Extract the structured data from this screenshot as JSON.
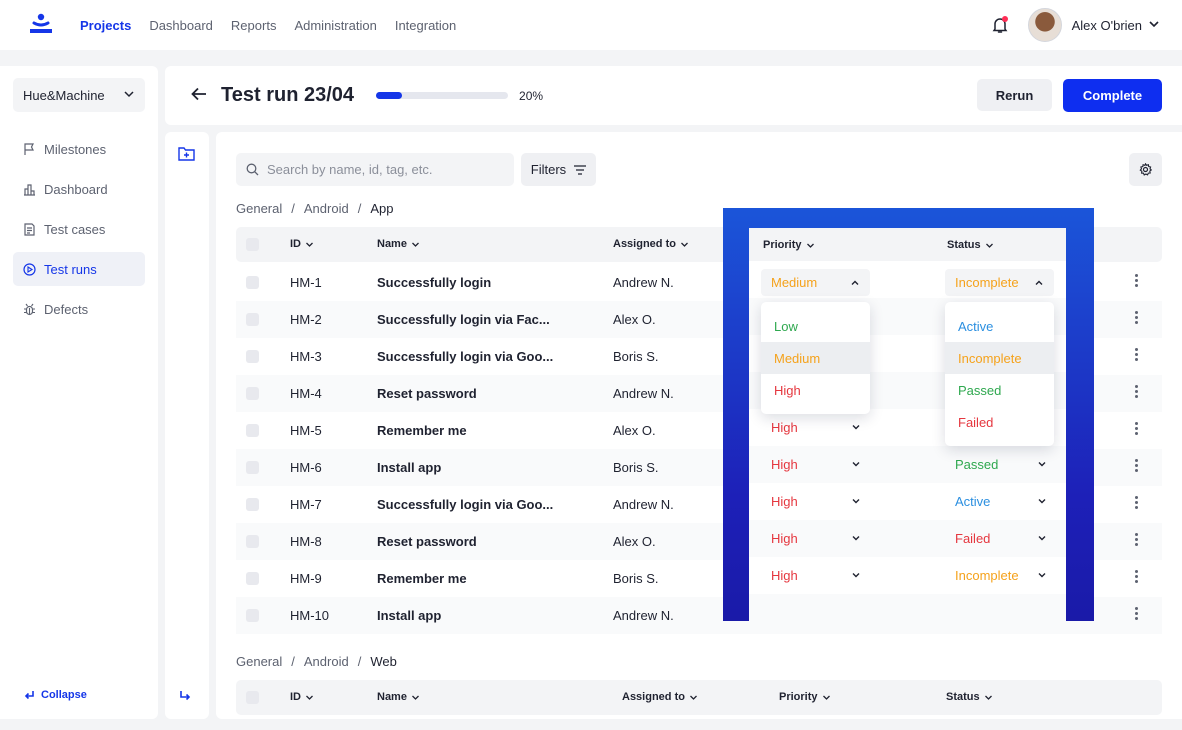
{
  "nav": {
    "items": [
      "Projects",
      "Dashboard",
      "Reports",
      "Administration",
      "Integration"
    ],
    "active": 0,
    "user_name": "Alex O'brien"
  },
  "sidebar": {
    "org": "Hue&Machine",
    "items": [
      {
        "label": "Milestones",
        "icon": "flag-icon"
      },
      {
        "label": "Dashboard",
        "icon": "chart-icon"
      },
      {
        "label": "Test cases",
        "icon": "document-icon"
      },
      {
        "label": "Test runs",
        "icon": "play-circle-icon"
      },
      {
        "label": "Defects",
        "icon": "bug-icon"
      }
    ],
    "active": 3,
    "collapse_label": "Collapse"
  },
  "header": {
    "title": "Test run 23/04",
    "progress": 20,
    "progress_label": "20%",
    "rerun_label": "Rerun",
    "complete_label": "Complete"
  },
  "toolbar": {
    "search_placeholder": "Search by name, id, tag, etc.",
    "filters_label": "Filters"
  },
  "section1": {
    "breadcrumb": [
      "General",
      "Android",
      "App"
    ],
    "columns": [
      "ID",
      "Name",
      "Assigned to",
      "Priority",
      "Status"
    ],
    "rows": [
      {
        "id": "HM-1",
        "name": "Successfully login",
        "assigned": "Andrew N.",
        "priority": "Medium",
        "status": "Incomplete"
      },
      {
        "id": "HM-2",
        "name": "Successfully login via Fac...",
        "assigned": "Alex O.",
        "priority": "",
        "status": ""
      },
      {
        "id": "HM-3",
        "name": "Successfully login via Goo...",
        "assigned": "Boris S.",
        "priority": "",
        "status": ""
      },
      {
        "id": "HM-4",
        "name": "Reset password",
        "assigned": "Andrew N.",
        "priority": "",
        "status": ""
      },
      {
        "id": "HM-5",
        "name": "Remember me",
        "assigned": "Alex O.",
        "priority": "High",
        "status": ""
      },
      {
        "id": "HM-6",
        "name": "Install app",
        "assigned": "Boris S.",
        "priority": "High",
        "status": "Passed"
      },
      {
        "id": "HM-7",
        "name": "Successfully login via Goo...",
        "assigned": "Andrew N.",
        "priority": "High",
        "status": "Active"
      },
      {
        "id": "HM-8",
        "name": "Reset password",
        "assigned": "Alex O.",
        "priority": "High",
        "status": "Failed"
      },
      {
        "id": "HM-9",
        "name": "Remember me",
        "assigned": "Boris S.",
        "priority": "High",
        "status": "Incomplete"
      },
      {
        "id": "HM-10",
        "name": "Install app",
        "assigned": "Andrew N.",
        "priority": "",
        "status": ""
      }
    ]
  },
  "section2": {
    "breadcrumb": [
      "General",
      "Android",
      "Web"
    ],
    "columns": [
      "ID",
      "Name",
      "Assigned to",
      "Priority",
      "Status"
    ]
  },
  "priority_menu": {
    "options": [
      "Low",
      "Medium",
      "High"
    ],
    "selected": "Medium"
  },
  "status_menu": {
    "options": [
      "Active",
      "Incomplete",
      "Passed",
      "Failed"
    ],
    "selected": "Incomplete"
  },
  "colors": {
    "accent": "#1536e8",
    "low": "#2fa84f",
    "medium": "#f5a21b",
    "high": "#e5373f",
    "active": "#2b8fe0",
    "incomplete": "#f5a21b",
    "passed": "#2fa84f",
    "failed": "#e5373f"
  }
}
